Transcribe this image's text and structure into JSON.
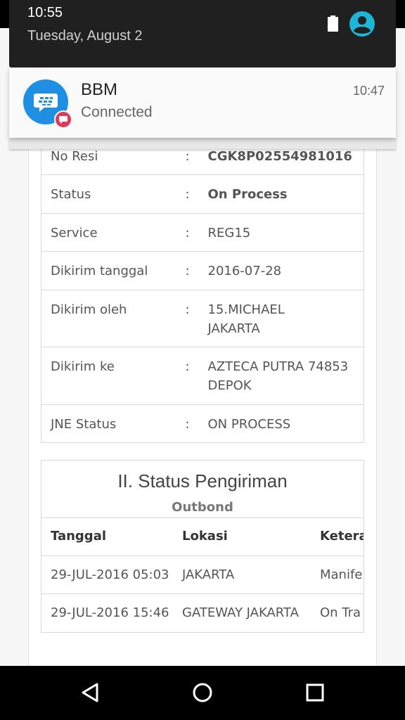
{
  "status_bar": {
    "time": "10:55",
    "date": "Tuesday, August 2",
    "battery_icon": "battery-full-icon",
    "account_icon": "account-circle-icon",
    "accent_color": "#1fb5d6"
  },
  "notification": {
    "app_name": "BBM",
    "text": "Connected",
    "time": "10:47",
    "icon": "bbm-icon",
    "badge_icon": "bbm-chat-badge-icon",
    "icon_color": "#1e8fe3",
    "badge_color": "#e03a5a"
  },
  "shipment": {
    "rows": [
      {
        "label": "No Resi",
        "sep": ":",
        "value": "CGK8P02554981016"
      },
      {
        "label": "Status",
        "sep": ":",
        "value": "On Process"
      },
      {
        "label": "Service",
        "sep": ":",
        "value": "REG15"
      },
      {
        "label": "Dikirim tanggal",
        "sep": ":",
        "value": "2016-07-28"
      },
      {
        "label": "Dikirim oleh",
        "sep": ":",
        "value_line1": "15.MICHAEL",
        "value_line2": "JAKARTA"
      },
      {
        "label": "Dikirim ke",
        "sep": ":",
        "value_line1": "AZTECA PUTRA 74853",
        "value_line2": "DEPOK"
      },
      {
        "label": "JNE Status",
        "sep": ":",
        "value": "ON PROCESS"
      }
    ]
  },
  "status_section": {
    "title": "II. Status Pengiriman",
    "subtitle": "Outbond",
    "headers": [
      "Tanggal",
      "Lokasi",
      "Ketera"
    ],
    "rows": [
      [
        "29-JUL-2016 05:03",
        "JAKARTA",
        "Manife"
      ],
      [
        "29-JUL-2016 15:46",
        "GATEWAY JAKARTA",
        "On Tra"
      ]
    ]
  },
  "nav": {
    "back_icon": "back-triangle-icon",
    "home_icon": "home-circle-icon",
    "recents_icon": "recents-square-icon"
  }
}
